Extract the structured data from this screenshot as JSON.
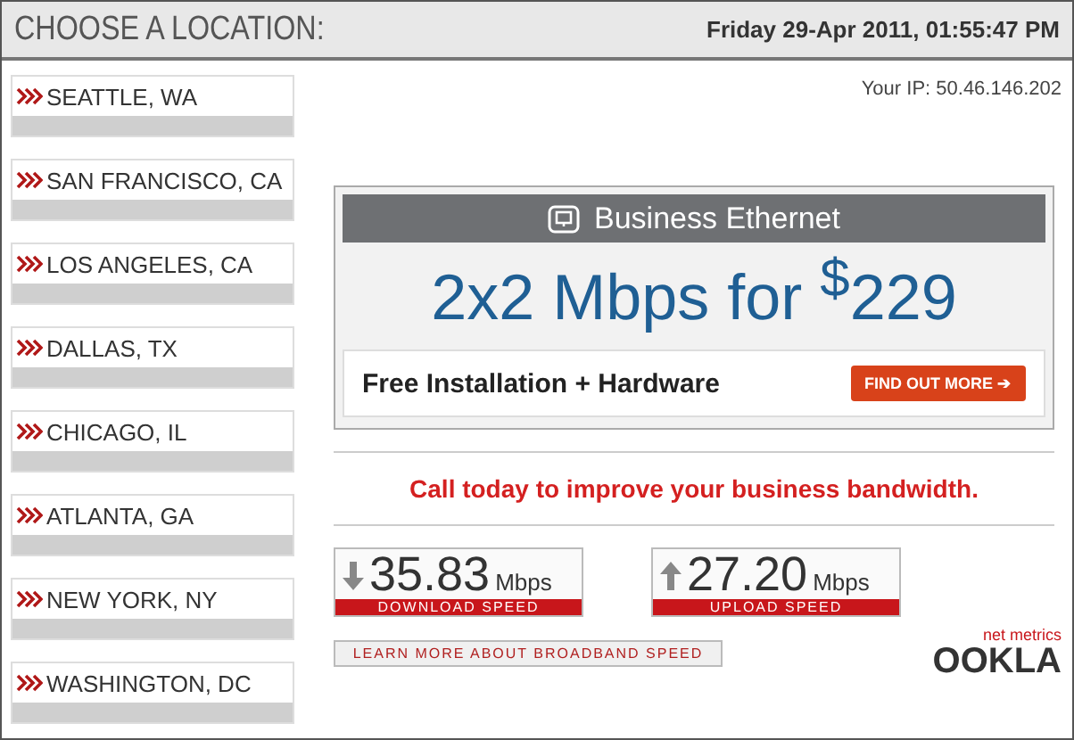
{
  "header": {
    "title": "CHOOSE A LOCATION:",
    "datetime": "Friday 29-Apr 2011, 01:55:47 PM"
  },
  "locations": [
    "SEATTLE, WA",
    "SAN FRANCISCO, CA",
    "LOS ANGELES, CA",
    "DALLAS, TX",
    "CHICAGO, IL",
    "ATLANTA, GA",
    "NEW YORK, NY",
    "WASHINGTON, DC"
  ],
  "ip": "Your IP: 50.46.146.202",
  "ad": {
    "title": "Business Ethernet",
    "offer": "2x2 Mbps for $^{$}$229",
    "tagline": "Free Installation + Hardware",
    "button": "FIND OUT MORE ➔"
  },
  "call_text": "Call today to improve your business bandwidth.",
  "speeds": [
    {
      "kind": "download",
      "value": "35.83",
      "unit": "Mbps",
      "label": "DOWNLOAD SPEED"
    },
    {
      "kind": "upload",
      "value": "27.20",
      "unit": "Mbps",
      "label": "UPLOAD SPEED"
    }
  ],
  "learn_more": "LEARN MORE ABOUT BROADBAND SPEED",
  "logo": {
    "tag": "net metrics",
    "name": "OOKLA"
  }
}
